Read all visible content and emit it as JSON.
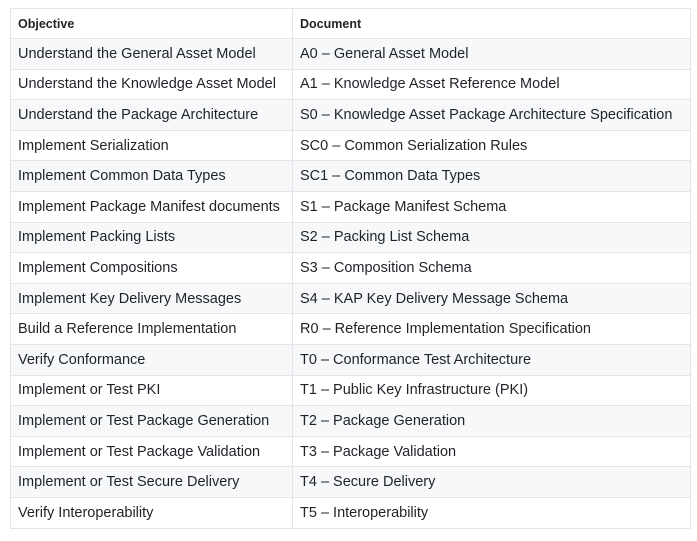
{
  "table": {
    "headers": [
      "Objective",
      "Document"
    ],
    "rows": [
      [
        "Understand the General Asset Model",
        "A0 – General Asset Model"
      ],
      [
        "Understand the Knowledge Asset Model",
        "A1 – Knowledge Asset Reference Model"
      ],
      [
        "Understand the Package Architecture",
        "S0 – Knowledge Asset Package Architecture Specification"
      ],
      [
        "Implement Serialization",
        "SC0 – Common Serialization Rules"
      ],
      [
        "Implement Common Data Types",
        "SC1 – Common Data Types"
      ],
      [
        "Implement Package Manifest documents",
        "S1 – Package Manifest Schema"
      ],
      [
        "Implement Packing Lists",
        "S2 – Packing List Schema"
      ],
      [
        "Implement Compositions",
        "S3 – Composition Schema"
      ],
      [
        "Implement Key Delivery Messages",
        "S4 – KAP Key Delivery Message Schema"
      ],
      [
        "Build a Reference Implementation",
        "R0 – Reference Implementation Specification"
      ],
      [
        "Verify Conformance",
        "T0 – Conformance Test Architecture"
      ],
      [
        "Implement or Test PKI",
        "T1 – Public Key Infrastructure (PKI)"
      ],
      [
        "Implement or Test Package Generation",
        "T2 – Package Generation"
      ],
      [
        "Implement or Test Package Validation",
        "T3 – Package Validation"
      ],
      [
        "Implement or Test Secure Delivery",
        "T4 – Secure Delivery"
      ],
      [
        "Verify Interoperability",
        "T5 – Interoperability"
      ]
    ]
  }
}
